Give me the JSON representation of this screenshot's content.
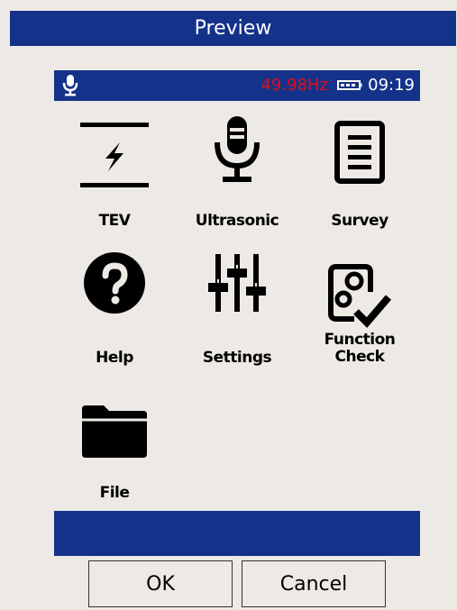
{
  "window": {
    "title": "Preview"
  },
  "status": {
    "frequency": "49.98Hz",
    "time": "09:19",
    "freq_color": "#e01010"
  },
  "menu": {
    "items": [
      {
        "label": "TEV",
        "icon": "tev-icon"
      },
      {
        "label": "Ultrasonic",
        "icon": "microphone-icon"
      },
      {
        "label": "Survey",
        "icon": "document-icon"
      },
      {
        "label": "Help",
        "icon": "help-icon"
      },
      {
        "label": "Settings",
        "icon": "sliders-icon"
      },
      {
        "label": "Function\nCheck",
        "icon": "function-check-icon"
      },
      {
        "label": "File",
        "icon": "folder-icon"
      }
    ]
  },
  "buttons": {
    "ok": "OK",
    "cancel": "Cancel"
  },
  "colors": {
    "accent": "#15328a",
    "background": "#ede9e4"
  }
}
